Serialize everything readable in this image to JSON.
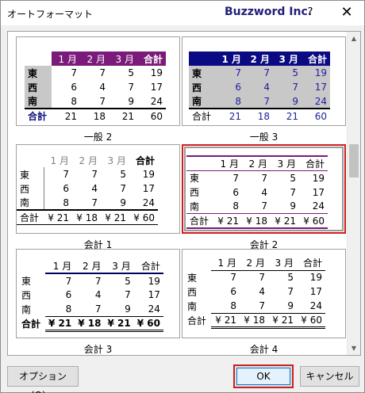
{
  "dialog": {
    "title": "オートフォーマット",
    "brand": "Buzzword Inc.",
    "help_label": "?",
    "close_label": "✕"
  },
  "formats": [
    {
      "id": "general2",
      "label": "一般 2",
      "header": [
        "",
        "1 月",
        "2 月",
        "3 月",
        "合計"
      ],
      "rows": [
        [
          "東",
          "7",
          "7",
          "5",
          "19"
        ],
        [
          "西",
          "6",
          "4",
          "7",
          "17"
        ],
        [
          "南",
          "8",
          "7",
          "9",
          "24"
        ]
      ],
      "total": [
        "合計",
        "21",
        "18",
        "21",
        "60"
      ]
    },
    {
      "id": "general3",
      "label": "一般 3",
      "header": [
        "",
        "1 月",
        "2 月",
        "3 月",
        "合計"
      ],
      "rows": [
        [
          "東",
          "7",
          "7",
          "5",
          "19"
        ],
        [
          "西",
          "6",
          "4",
          "7",
          "17"
        ],
        [
          "南",
          "8",
          "7",
          "9",
          "24"
        ]
      ],
      "total": [
        "合計",
        "21",
        "18",
        "21",
        "60"
      ]
    },
    {
      "id": "accounting1",
      "label": "会計 1",
      "header": [
        "",
        "1 月",
        "2 月",
        "3 月",
        "合計"
      ],
      "rows": [
        [
          "東",
          "7",
          "7",
          "5",
          "19"
        ],
        [
          "西",
          "6",
          "4",
          "7",
          "17"
        ],
        [
          "南",
          "8",
          "7",
          "9",
          "24"
        ]
      ],
      "total": [
        "合計",
        "¥ 21",
        "¥ 18",
        "¥ 21",
        "¥ 60"
      ]
    },
    {
      "id": "accounting2",
      "label": "会計 2",
      "header": [
        "",
        "1 月",
        "2 月",
        "3 月",
        "合計"
      ],
      "rows": [
        [
          "東",
          "7",
          "7",
          "5",
          "19"
        ],
        [
          "西",
          "6",
          "4",
          "7",
          "17"
        ],
        [
          "南",
          "8",
          "7",
          "9",
          "24"
        ]
      ],
      "total": [
        "合計",
        "¥ 21",
        "¥ 18",
        "¥ 21",
        "¥ 60"
      ]
    },
    {
      "id": "accounting3",
      "label": "会計 3",
      "header": [
        "",
        "1 月",
        "2 月",
        "3 月",
        "合計"
      ],
      "rows": [
        [
          "東",
          "7",
          "7",
          "5",
          "19"
        ],
        [
          "西",
          "6",
          "4",
          "7",
          "17"
        ],
        [
          "南",
          "8",
          "7",
          "9",
          "24"
        ]
      ],
      "total": [
        "合計",
        "¥ 21",
        "¥ 18",
        "¥ 21",
        "¥ 60"
      ]
    },
    {
      "id": "accounting4",
      "label": "会計 4",
      "header": [
        "",
        "1 月",
        "2 月",
        "3 月",
        "合計"
      ],
      "rows": [
        [
          "東",
          "7",
          "7",
          "5",
          "19"
        ],
        [
          "西",
          "6",
          "4",
          "7",
          "17"
        ],
        [
          "南",
          "8",
          "7",
          "9",
          "24"
        ]
      ],
      "total": [
        "合計",
        "¥ 21",
        "¥ 18",
        "¥ 21",
        "¥ 60"
      ]
    }
  ],
  "selected_format": "accounting2",
  "buttons": {
    "options": "オプション(O)...",
    "ok": "OK",
    "cancel": "キャンセル"
  },
  "colors": {
    "general2_header": "#7a1a7a",
    "general3_header": "#0a0a82",
    "selection_highlight": "#cc2020"
  }
}
